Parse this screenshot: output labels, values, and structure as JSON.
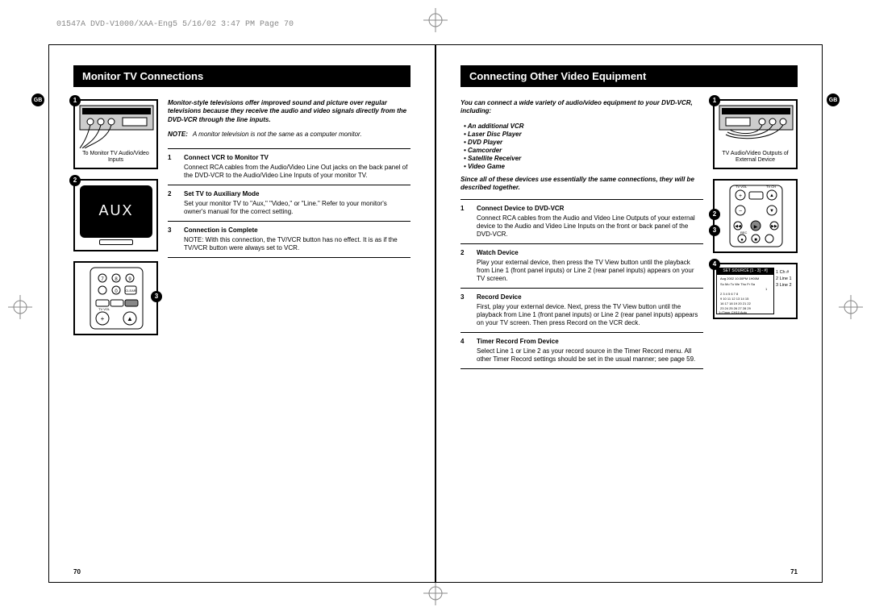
{
  "header": "01547A DVD-V1000/XAA-Eng5  5/16/02 3:47 PM  Page 70",
  "gb_label": "GB",
  "left_page": {
    "title": "Monitor TV Connections",
    "intro": "Monitor-style televisions offer improved sound and picture over regular televisions because they receive the audio and video signals directly from the DVD-VCR through the line inputs.",
    "note_label": "NOTE:",
    "note_text": "A monitor television is not the same as a computer monitor.",
    "figure1_caption": "To Monitor TV Audio/Video Inputs",
    "aux_label": "AUX",
    "steps": [
      {
        "num": "1",
        "title": "Connect VCR to Monitor TV",
        "text": "Connect RCA cables from the Audio/Video Line Out jacks on the back panel of the DVD-VCR to the Audio/Video Line Inputs of your monitor TV."
      },
      {
        "num": "2",
        "title": "Set TV to Auxiliary Mode",
        "text": "Set your monitor TV to \"Aux,\" \"Video,\" or \"Line.\" Refer to your monitor's owner's manual for the correct setting."
      },
      {
        "num": "3",
        "title": "Connection is Complete",
        "text": "NOTE: With this connection, the TV/VCR button has no effect. It is as if the TV/VCR button were always set to VCR."
      }
    ],
    "page_num": "70"
  },
  "right_page": {
    "title": "Connecting Other Video Equipment",
    "intro": "You can connect a wide variety of audio/video equipment to your DVD-VCR, including:",
    "bullets": [
      "An additional VCR",
      "Laser Disc Player",
      "DVD Player",
      "Camcorder",
      "Satellite Receiver",
      "Video Game"
    ],
    "intro2": "Since all of these devices use essentially the same connections, they will be described together.",
    "figure1_caption": "TV Audio/Video Outputs of External Device",
    "steps": [
      {
        "num": "1",
        "title": "Connect Device to DVD-VCR",
        "text": "Connect RCA cables from the Audio and Video Line Outputs of your external device to the Audio and Video Line Inputs on the front or back panel of the DVD-VCR."
      },
      {
        "num": "2",
        "title": "Watch Device",
        "text": "Play your external device, then press the TV View button until the playback from Line 1 (front panel inputs) or Line 2 (rear panel inputs) appears on your TV screen."
      },
      {
        "num": "3",
        "title": "Record Device",
        "text": "First, play your external device. Next, press the TV View button until the playback from Line 1 (front panel inputs) or Line 2 (rear panel inputs) appears on your TV screen. Then press Record on the VCR deck."
      },
      {
        "num": "4",
        "title": "Timer Record From Device",
        "text": "Select Line 1 or Line 2 as your record source in the Timer Record menu. All other Timer Record settings should be set in the usual manner; see page 59."
      }
    ],
    "table_header": "SET SOURCE [1 - 3] - #]",
    "table_side": [
      "1  Ch #",
      "2  Line 1",
      "3  Line 2"
    ],
    "page_num": "71"
  }
}
